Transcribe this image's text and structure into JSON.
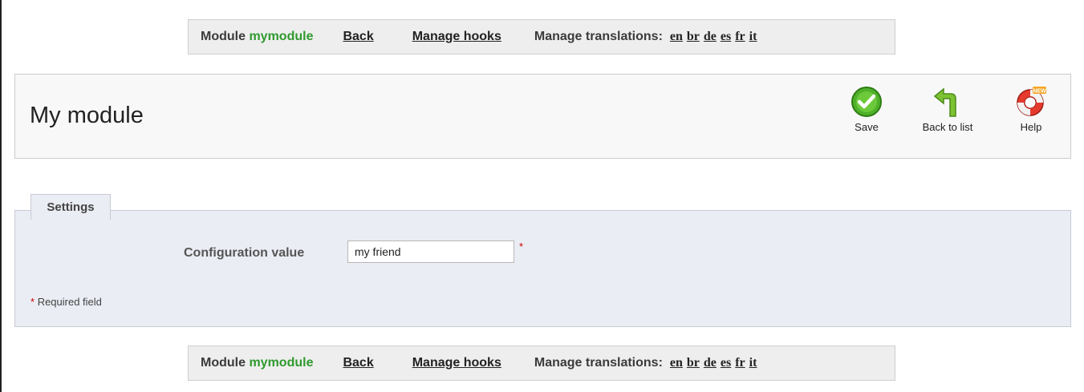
{
  "nav": {
    "module_prefix": "Module",
    "module_name": "mymodule",
    "back": "Back",
    "manage_hooks": "Manage hooks",
    "manage_translations": "Manage translations:",
    "languages": [
      "en",
      "br",
      "de",
      "es",
      "fr",
      "it"
    ]
  },
  "toolbar": {
    "title": "My module",
    "save_label": "Save",
    "back_to_list_label": "Back to list",
    "help_label": "Help",
    "help_badge": "NEW"
  },
  "settings": {
    "legend": "Settings",
    "config_label": "Configuration value",
    "config_value": "my friend",
    "required_star": "*",
    "required_note": "Required field"
  },
  "colors": {
    "module_name": "#2f9a2f",
    "required": "#cc0000",
    "panel_bg": "#ebedf4"
  }
}
